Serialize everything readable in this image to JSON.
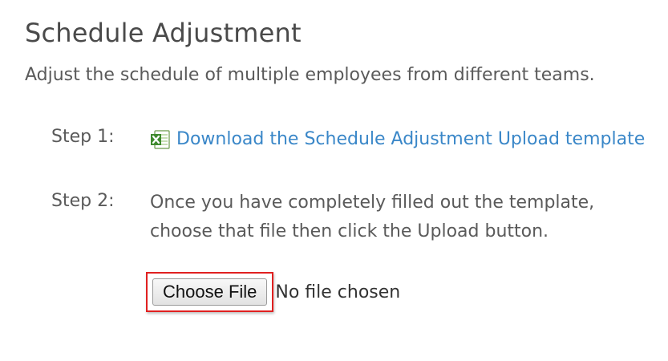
{
  "page": {
    "title": "Schedule Adjustment",
    "subtitle": "Adjust the schedule of multiple employees from different teams."
  },
  "step1": {
    "label": "Step 1:",
    "icon": "excel-file-icon",
    "link_text": "Download the Schedule Adjustment Upload template"
  },
  "step2": {
    "label": "Step 2:",
    "instructions_line1": "Once you have completely filled out the template,",
    "instructions_line2": "choose that file then click the Upload button."
  },
  "file_input": {
    "button_label": "Choose File",
    "status_text": "No file chosen"
  },
  "colors": {
    "link": "#3a87c8",
    "highlight_border": "#e02020",
    "text": "#5a5a5a"
  }
}
